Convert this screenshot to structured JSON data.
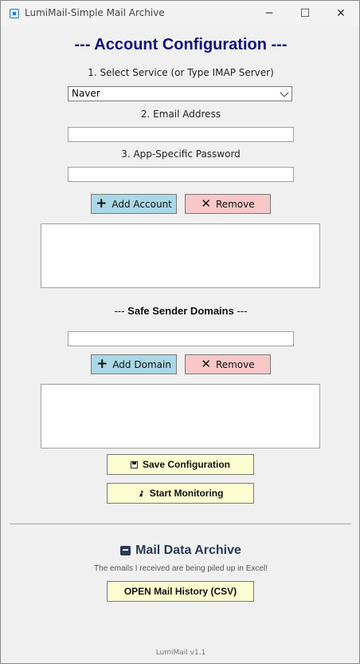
{
  "window": {
    "title": "LumiMail-Simple Mail Archive",
    "controls": {
      "minimize": "─",
      "maximize": "☐",
      "close": "✕"
    }
  },
  "account_config": {
    "heading": "--- Account Configuration ---",
    "service_label": "1. Select Service (or Type IMAP Server)",
    "service_value": "Naver",
    "email_label": "2. Email Address",
    "email_value": "",
    "password_label": "3. App-Specific Password",
    "password_value": "",
    "add_button": "Add Account",
    "remove_button": "Remove",
    "accounts": []
  },
  "safe_senders": {
    "heading_prefix": "--- ",
    "heading_text": "Safe Sender Domains",
    "heading_suffix": " ---",
    "domain_value": "",
    "add_button": "Add Domain",
    "remove_button": "Remove",
    "domains": []
  },
  "actions": {
    "save": "Save Configuration",
    "start": "Start Monitoring"
  },
  "archive": {
    "title": "Mail Data Archive",
    "note": "The emails I received are being piled up in Excel!",
    "open_button": "OPEN Mail History (CSV)"
  },
  "footer": {
    "version": "LumiMail v1.1"
  },
  "icons": {
    "add": "plus-icon",
    "remove": "x-icon",
    "save": "floppy-disk-icon",
    "start": "rocket-icon",
    "archive": "archive-box-icon"
  },
  "colors": {
    "heading": "#12127a",
    "add_button_bg": "#aad8e6",
    "remove_button_bg": "#f9c7c7",
    "action_button_bg": "#fdfdd2",
    "archive_title": "#2b3a55"
  }
}
